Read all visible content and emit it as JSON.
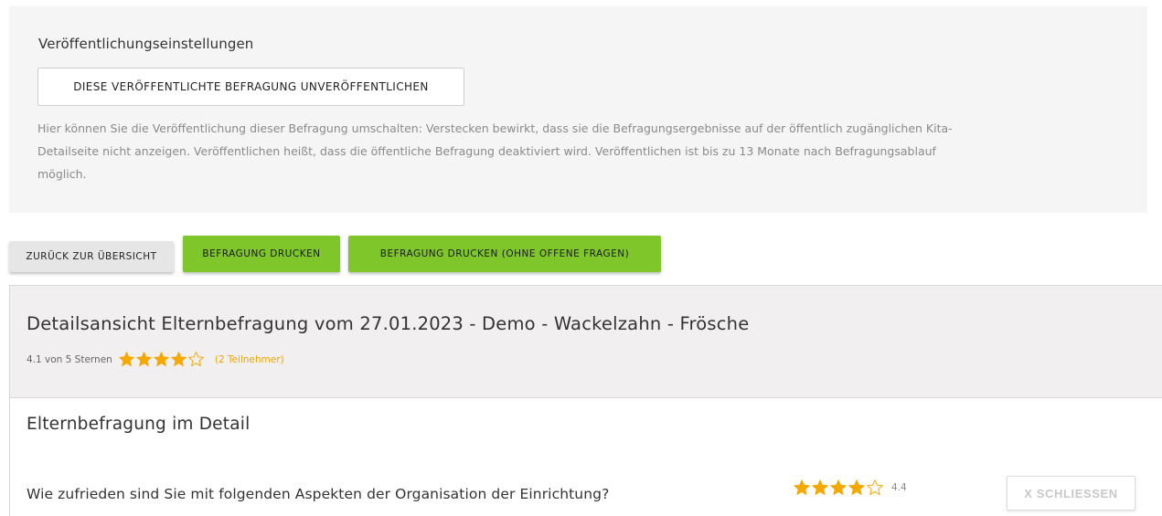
{
  "publication": {
    "title": "Veröffentlichungseinstellungen",
    "unpublish_button": "DIESE VERÖFFENTLICHTE BEFRAGUNG UNVERÖFFENTLICHEN",
    "description_line1": "Hier können Sie die Veröffentlichung dieser Befragung umschalten: Verstecken bewirkt, dass sie die Befragungsergebnisse auf der öffentlich zugänglichen Kita-",
    "description_line2": "Detailseite nicht anzeigen. Veröffentlichen heißt, dass die öffentliche Befragung deaktiviert wird. Veröffentlichen ist bis zu 13 Monate nach Befragungsablauf",
    "description_line3": "möglich."
  },
  "actions": {
    "back_label": "ZURÜCK ZUR ÜBERSICHT",
    "print_label": "BEFRAGUNG DRUCKEN",
    "print_no_open_label": "BEFRAGUNG DRUCKEN (OHNE OFFENE FRAGEN)"
  },
  "detail": {
    "title": "Detailsansicht Elternbefragung vom 27.01.2023 - Demo - Wackelzahn - Frösche",
    "rating_text": "4.1 von 5 Sternen",
    "rating_value": 4.1,
    "rating_max": 5,
    "participants": "(2 Teilnehmer)"
  },
  "section": {
    "title": "Elternbefragung im Detail",
    "question": "Wie zufrieden sind Sie mit folgenden Aspekten der Organisation der Einrichtung?",
    "question_rating": 4.4,
    "question_score": "4.4",
    "close_label": "X SCHLIESSEN"
  },
  "colors": {
    "star": "#f5a800",
    "green_button": "#7fc62b",
    "participants": "#f0a500"
  },
  "icons": [
    "star-filled-icon",
    "star-empty-icon"
  ]
}
